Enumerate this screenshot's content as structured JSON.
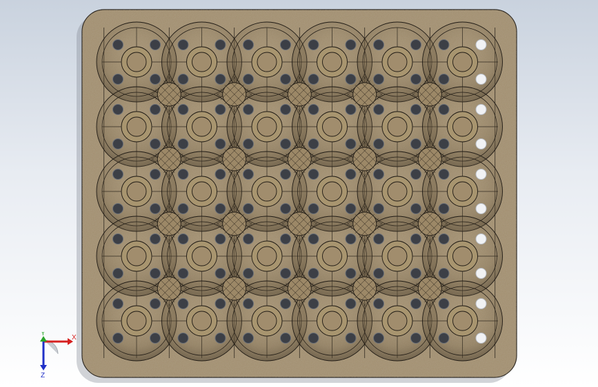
{
  "viewport": {
    "background_top": "#c9d2de",
    "background_bottom": "#ffffff"
  },
  "model": {
    "material_color": "#a18d6d",
    "material_dark": "#7a6a50",
    "edge_color": "#1f1a14",
    "hole_color": "#3c3f46",
    "hole_rim_color": "#6b7078",
    "grid_rows": 5,
    "grid_cols": 6
  },
  "triad": {
    "x_label": "X",
    "y_label": "Y",
    "z_label": "Z",
    "x_color": "#d62020",
    "y_color": "#2aa52a",
    "z_color": "#2030c8"
  }
}
